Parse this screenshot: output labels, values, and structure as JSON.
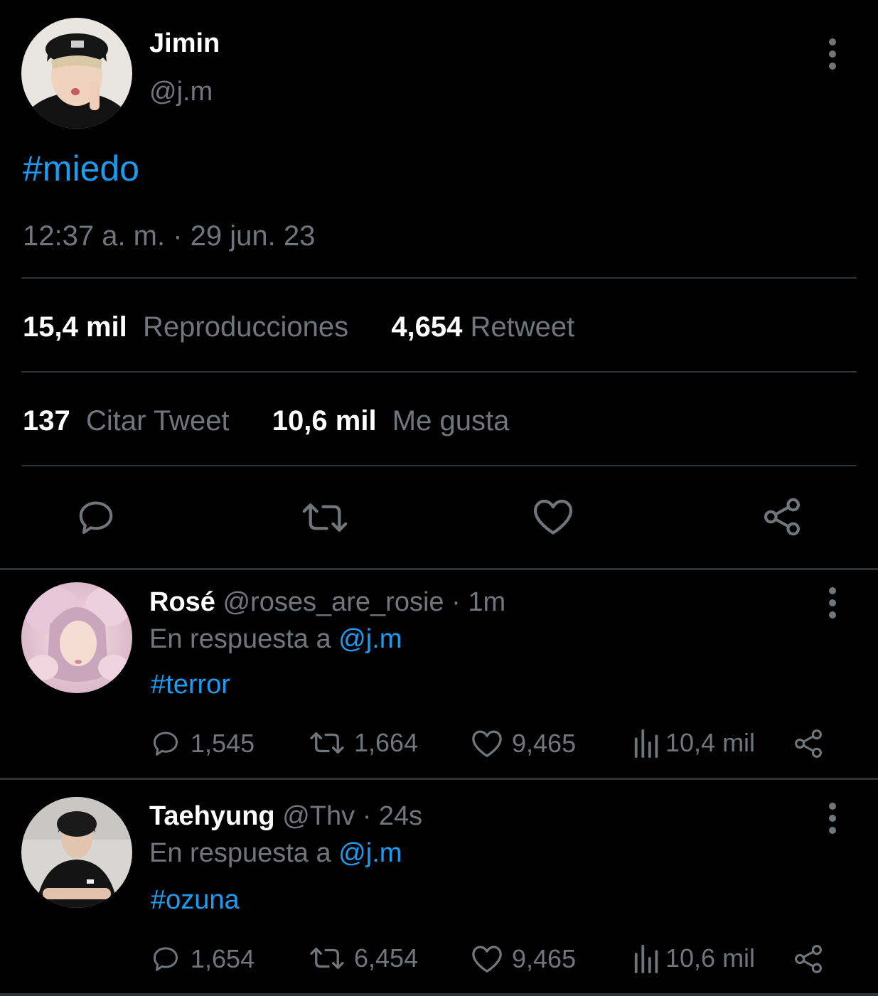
{
  "main": {
    "author_name": "Jimin",
    "author_handle": "@j.m",
    "text": "#miedo",
    "timestamp": "12:37 a. m. · 29 jun. 23",
    "stats": {
      "views_count": "15,4 mil",
      "views_label": "Reproducciones",
      "retweets_count": "4,654",
      "retweets_label": "Retweet",
      "quotes_count": "137",
      "quotes_label": "Citar Tweet",
      "likes_count": "10,6 mil",
      "likes_label": "Me gusta"
    },
    "icons": [
      "reply-icon",
      "retweet-icon",
      "like-icon",
      "share-icon"
    ]
  },
  "replies": [
    {
      "name": "Rosé",
      "handle": "@roses_are_rosie",
      "age": "1m",
      "reply_prefix": "En respuesta a",
      "reply_to": "@j.m",
      "text": "#terror",
      "replies": "1,545",
      "retweets": "1,664",
      "likes": "9,465",
      "views": "10,4 mil"
    },
    {
      "name": "Taehyung",
      "handle": "@Thv",
      "age": "24s",
      "reply_prefix": "En respuesta a",
      "reply_to": "@j.m",
      "text": "#ozuna",
      "replies": "1,654",
      "retweets": "6,454",
      "likes": "9,465",
      "views": "10,6 mil"
    }
  ],
  "colors": {
    "background": "#000000",
    "accent": "#1d9bf0",
    "muted": "#71767b",
    "divider": "#2f3336"
  }
}
